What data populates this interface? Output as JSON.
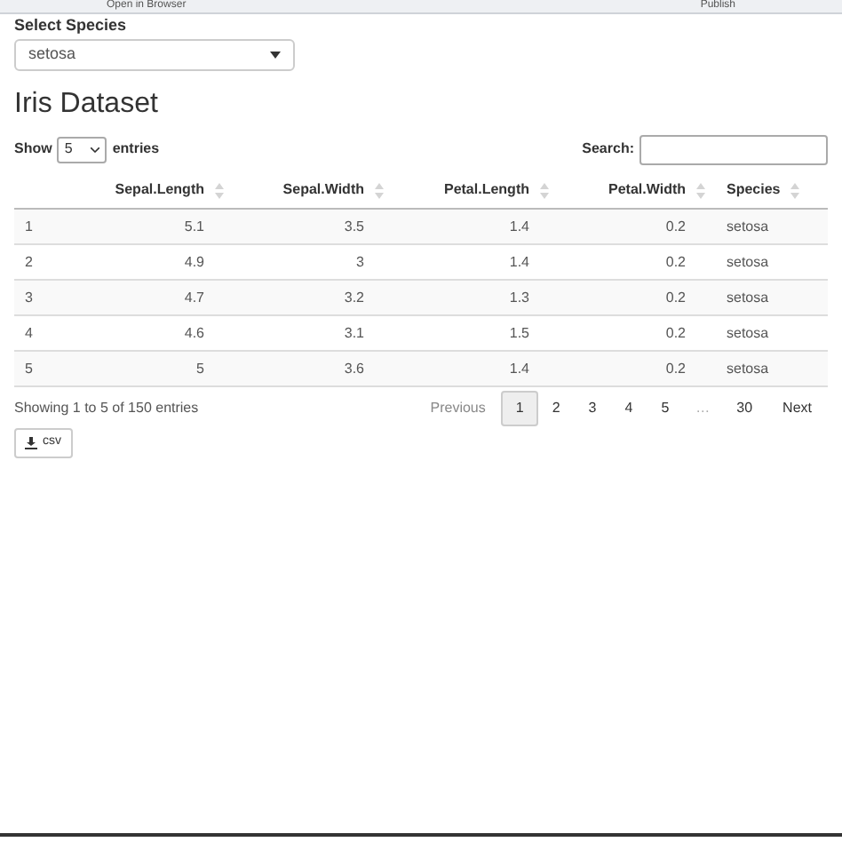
{
  "toolbar": {
    "open_label": "Open in Browser",
    "publish_label": "Publish"
  },
  "species_select": {
    "label": "Select Species",
    "value": "setosa"
  },
  "title": "Iris Dataset",
  "length_control": {
    "prefix": "Show",
    "value": "5",
    "suffix": "entries"
  },
  "search": {
    "label": "Search:"
  },
  "table": {
    "columns": [
      {},
      {
        "label": "Sepal.Length"
      },
      {
        "label": "Sepal.Width"
      },
      {
        "label": "Petal.Length"
      },
      {
        "label": "Petal.Width"
      },
      {
        "label": "Species"
      }
    ],
    "rows": [
      [
        "1",
        "5.1",
        "3.5",
        "1.4",
        "0.2",
        "setosa"
      ],
      [
        "2",
        "4.9",
        "3",
        "1.4",
        "0.2",
        "setosa"
      ],
      [
        "3",
        "4.7",
        "3.2",
        "1.3",
        "0.2",
        "setosa"
      ],
      [
        "4",
        "4.6",
        "3.1",
        "1.5",
        "0.2",
        "setosa"
      ],
      [
        "5",
        "5",
        "3.6",
        "1.4",
        "0.2",
        "setosa"
      ]
    ]
  },
  "info": "Showing 1 to 5 of 150 entries",
  "pagination": [
    {
      "label": "Previous",
      "kind": "nav",
      "disabled": true
    },
    {
      "label": "1",
      "kind": "page",
      "selected": true
    },
    {
      "label": "2",
      "kind": "page",
      "selected": false
    },
    {
      "label": "3",
      "kind": "page",
      "selected": false
    },
    {
      "label": "4",
      "kind": "page",
      "selected": false
    },
    {
      "label": "5",
      "kind": "page",
      "selected": false
    },
    {
      "label": "…",
      "kind": "ellipsis"
    },
    {
      "label": "30",
      "kind": "page",
      "selected": false
    },
    {
      "label": "Next",
      "kind": "nav",
      "disabled": false
    }
  ],
  "export_button": {
    "label": "csv"
  }
}
